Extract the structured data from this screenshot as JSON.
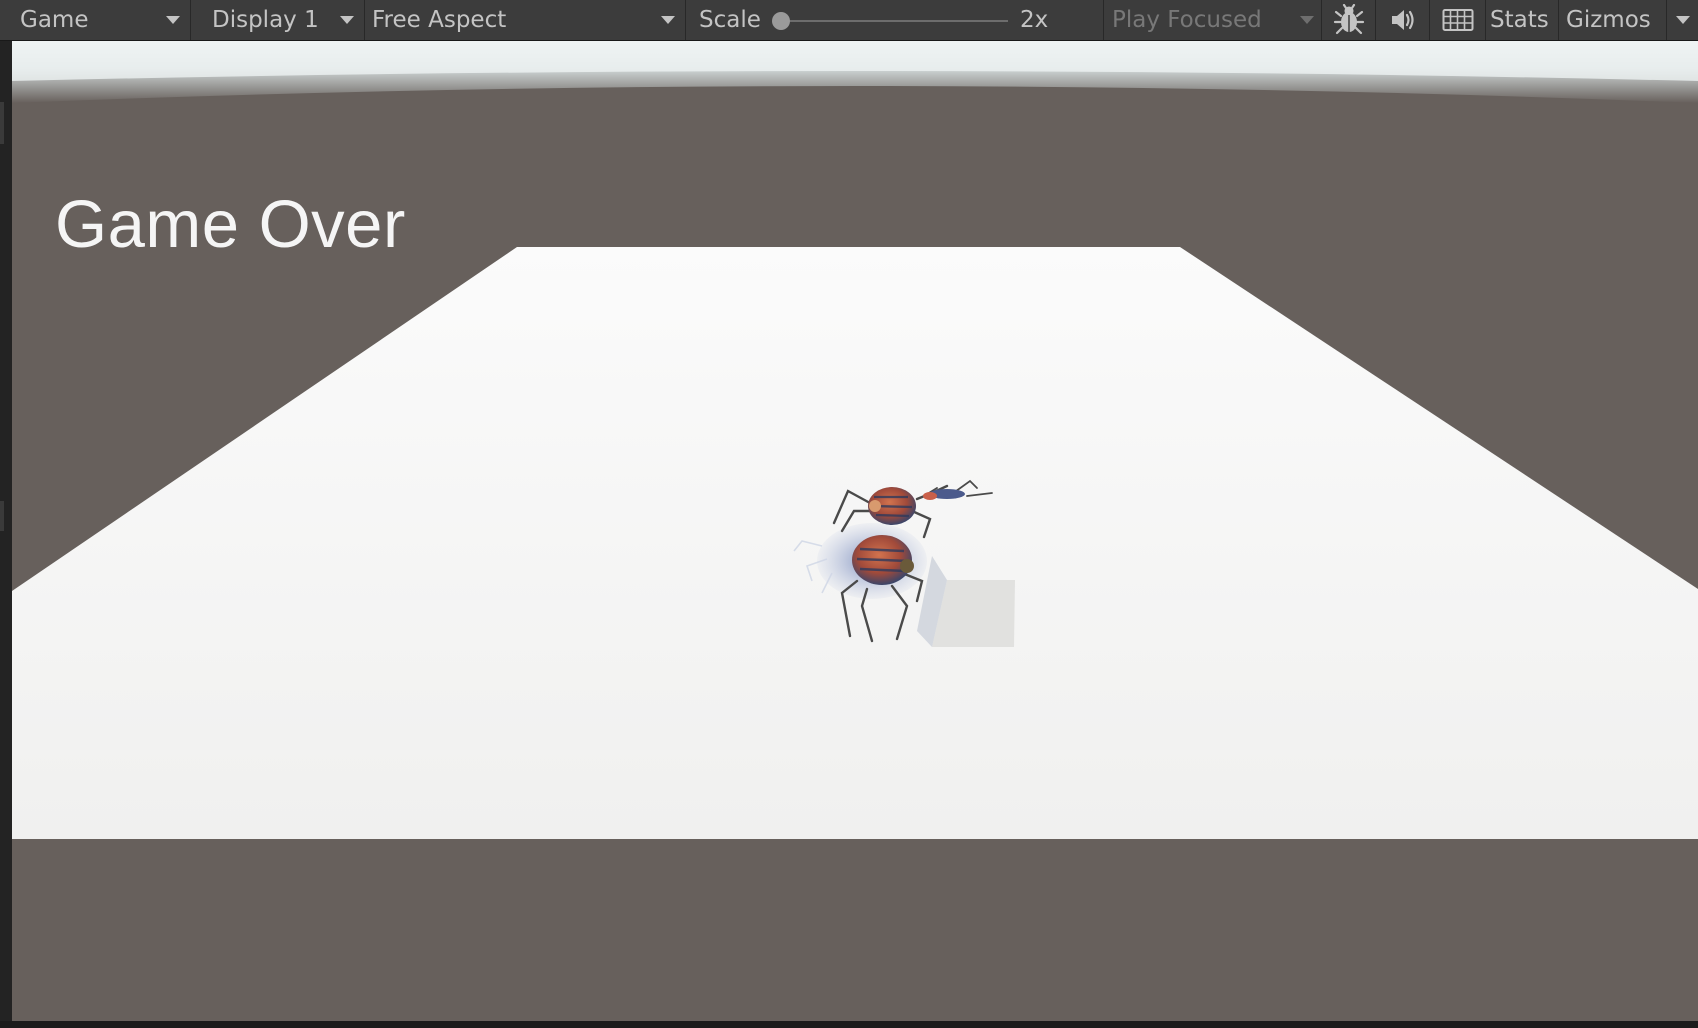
{
  "toolbar": {
    "view_mode": "Game",
    "display": "Display 1",
    "aspect": "Free Aspect",
    "scale_label": "Scale",
    "scale_value": "2x",
    "scale_level": 0,
    "play_mode": "Play Focused",
    "stats_label": "Stats",
    "gizmos_label": "Gizmos",
    "icons": [
      "bug-icon",
      "speaker-icon",
      "keyboard-icon"
    ]
  },
  "game": {
    "message": "Game Over"
  },
  "colors": {
    "toolbar_bg": "#3c3c3c",
    "ground_bg": "#67605c",
    "platform": "#f2f2f1",
    "sky": "#f2f5f5",
    "text": "#f5f5f5"
  }
}
